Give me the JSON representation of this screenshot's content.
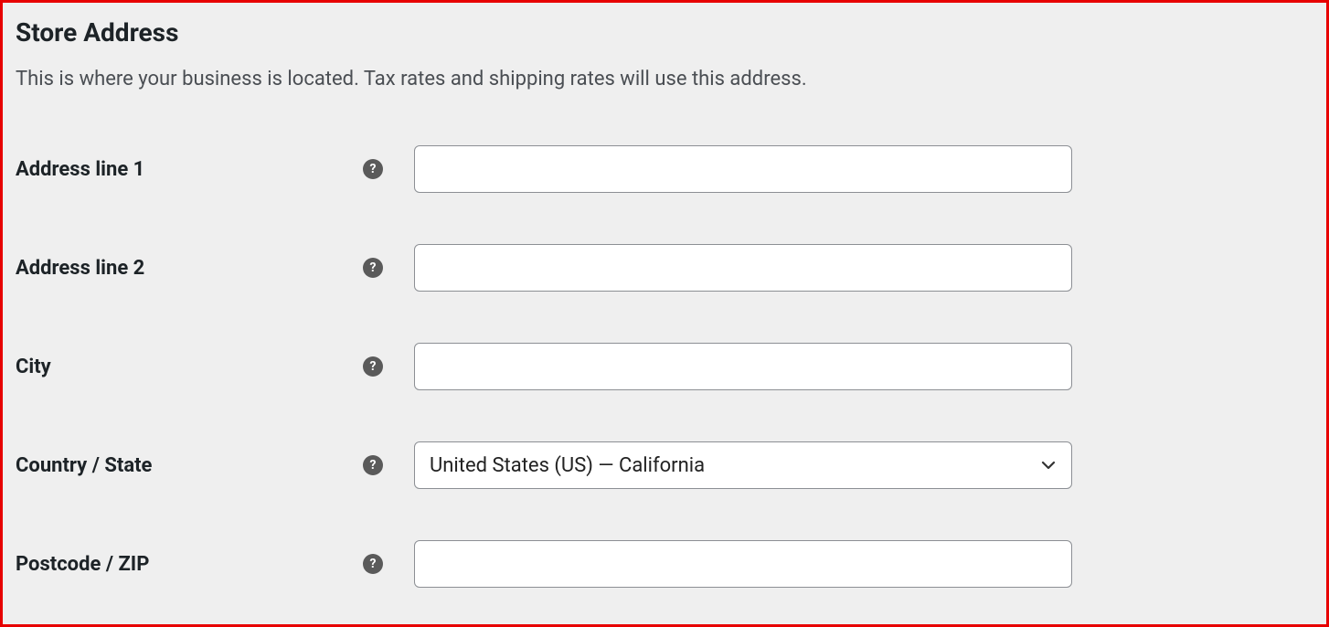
{
  "header": {
    "title": "Store Address",
    "description": "This is where your business is located. Tax rates and shipping rates will use this address."
  },
  "fields": {
    "address1": {
      "label": "Address line 1",
      "value": ""
    },
    "address2": {
      "label": "Address line 2",
      "value": ""
    },
    "city": {
      "label": "City",
      "value": ""
    },
    "country_state": {
      "label": "Country / State",
      "selected": "United States (US) — California"
    },
    "postcode": {
      "label": "Postcode / ZIP",
      "value": ""
    }
  },
  "icons": {
    "help_glyph": "?"
  }
}
